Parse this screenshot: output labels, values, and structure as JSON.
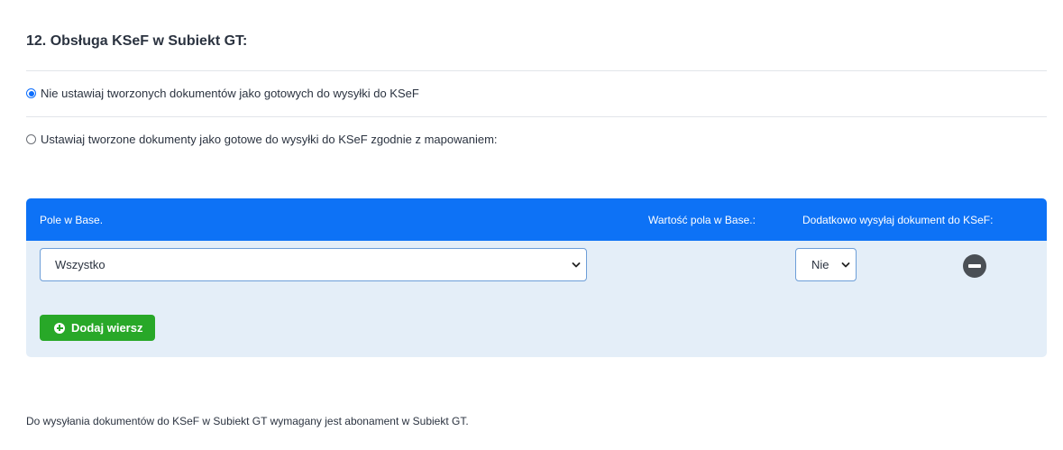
{
  "section": {
    "title": "12. Obsługa KSeF w Subiekt GT:"
  },
  "options": [
    {
      "label": "Nie ustawiaj tworzonych dokumentów jako gotowych do wysyłki do KSeF",
      "checked": true
    },
    {
      "label": "Ustawiaj tworzone dokumenty jako gotowe do wysyłki do KSeF zgodnie z mapowaniem:",
      "checked": false
    }
  ],
  "table": {
    "headers": {
      "field": "Pole w Base.",
      "value": "Wartość pola w Base.:",
      "extra": "Dodatkowo wysyłaj dokument do KSeF:"
    },
    "row": {
      "field_selected": "Wszystko",
      "send_selected": "Nie"
    },
    "add_row_label": "Dodaj wiersz"
  },
  "footer": {
    "note": "Do wysyłania dokumentów do KSeF w Subiekt GT wymagany jest abonament w Subiekt GT."
  },
  "colors": {
    "header_blue": "#0d72f6",
    "panel_bg": "#e4eef8",
    "add_green": "#28a828"
  }
}
